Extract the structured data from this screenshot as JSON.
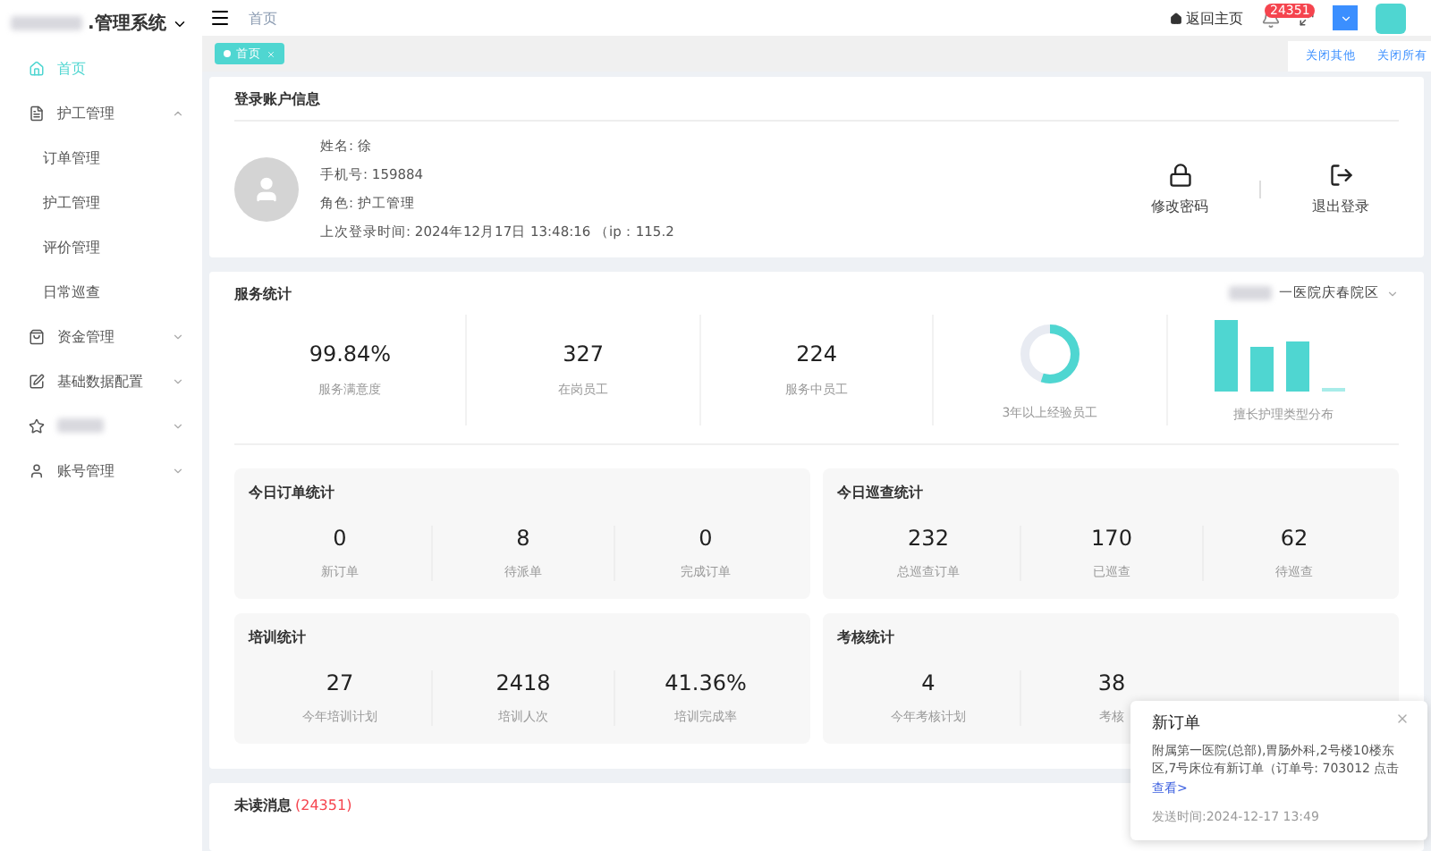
{
  "brand": {
    "title": ".管理系统"
  },
  "sidebar": {
    "items": [
      {
        "label": "首页",
        "selected": true
      },
      {
        "label": "护工管理",
        "selected": false,
        "expanded": true,
        "children": [
          {
            "label": "订单管理",
            "selected": false
          },
          {
            "label": "护工管理",
            "selected": false
          },
          {
            "label": "评价管理",
            "selected": false
          },
          {
            "label": "日常巡查",
            "selected": false
          }
        ]
      },
      {
        "label": "资金管理",
        "selected": false,
        "expanded": false
      },
      {
        "label": "基础数据配置",
        "selected": false,
        "expanded": false
      },
      {
        "selected": false,
        "expanded": false
      },
      {
        "label": "账号管理",
        "selected": false,
        "expanded": false
      }
    ]
  },
  "header": {
    "breadcrumb": "首页",
    "home_link": "返回主页",
    "badge": "24351"
  },
  "tabs": [
    {
      "label": "首页",
      "selected": true
    }
  ],
  "tab_actions": [
    "关闭其他",
    "关闭所有"
  ],
  "account": {
    "title": "登录账户信息",
    "fields": [
      {
        "label": "姓名:",
        "value": "徐"
      },
      {
        "label": "手机号:",
        "value": "159884"
      },
      {
        "label": "角色:",
        "value": "护工管理"
      },
      {
        "label": "上次登录时间:",
        "value": "2024年12月17日 13:48:16 （ip：115.2"
      }
    ],
    "actions": [
      {
        "label": "修改密码"
      },
      {
        "label": "退出登录"
      }
    ]
  },
  "service_stats": {
    "title": "服务统计",
    "scope": "一医院庆春院区",
    "items": [
      {
        "kind": "number",
        "value": "99.84%",
        "label": "服务满意度"
      },
      {
        "kind": "number",
        "value": "327",
        "label": "在岗员工"
      },
      {
        "kind": "number",
        "value": "224",
        "label": "服务中员工"
      },
      {
        "kind": "donut",
        "level": 0.55,
        "label": "3年以上经验员工"
      },
      {
        "kind": "bars",
        "label": "擅长护理类型分布"
      }
    ]
  },
  "panels": [
    {
      "title": "今日订单统计",
      "items": [
        {
          "value": "0",
          "label": "新订单"
        },
        {
          "value": "8",
          "label": "待派单"
        },
        {
          "value": "0",
          "label": "完成订单"
        }
      ]
    },
    {
      "title": "今日巡查统计",
      "items": [
        {
          "value": "232",
          "label": "总巡查订单"
        },
        {
          "value": "170",
          "label": "已巡查"
        },
        {
          "value": "62",
          "label": "待巡查"
        }
      ]
    },
    {
      "title": "培训统计",
      "items": [
        {
          "value": "27",
          "label": "今年培训计划"
        },
        {
          "value": "2418",
          "label": "培训人次"
        },
        {
          "value": "41.36%",
          "label": "培训完成率"
        }
      ]
    },
    {
      "title": "考核统计",
      "items": [
        {
          "value": "4",
          "label": "今年考核计划"
        },
        {
          "value": "38",
          "label": "考核"
        }
      ]
    }
  ],
  "unread": {
    "title": "未读消息",
    "count": "(24351)"
  },
  "notification": {
    "title": "新订单",
    "body": "附属第一医院(总部),胃肠外科,2号楼10楼东区,7号床位有新订单（订单号: 703012 点击",
    "link": "查看>",
    "time": "发送时间:2024-12-17 13:49"
  }
}
